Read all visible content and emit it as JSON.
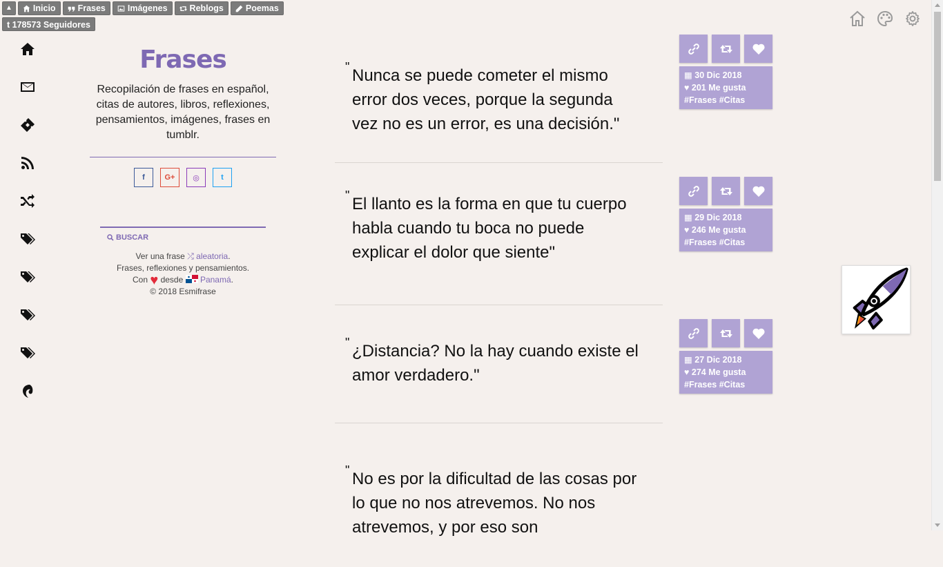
{
  "topbar": {
    "items": [
      {
        "label": "Inicio",
        "icon": "home-icon"
      },
      {
        "label": "Frases",
        "icon": "quote-icon"
      },
      {
        "label": "Imágenes",
        "icon": "image-icon"
      },
      {
        "label": "Reblogs",
        "icon": "retweet-icon"
      },
      {
        "label": "Poemas",
        "icon": "pencil-icon"
      }
    ],
    "followers_label": "178573 Seguidores"
  },
  "sidebar": {
    "title": "Frases",
    "description": "Recopilación de frases en español, citas de autores, libros, reflexiones, pensamientos, imágenes, frases en tumblr.",
    "search_label": "BUSCAR",
    "footer": {
      "line1_prefix": "Ver una frase",
      "line1_link": "aleatoria",
      "line1_suffix": ".",
      "line2": "Frases, reflexiones y pensamientos.",
      "line3_prefix": "Con",
      "line3_mid": "desde",
      "line3_link": "Panamá",
      "line3_suffix": ".",
      "line4": "© 2018 Esmifrase"
    },
    "social": [
      "f",
      "G+",
      "◎",
      "t"
    ]
  },
  "posts": [
    {
      "quote": "Nunca se puede cometer el mismo error dos veces, porque la segunda vez no es un error, es una decisión.\"",
      "date": "30 Dic 2018",
      "likes": "201 Me gusta",
      "tags": "#Frases #Citas"
    },
    {
      "quote": "El llanto es la forma en que tu cuerpo habla cuando tu boca no puede explicar el dolor que siente\"",
      "date": "29 Dic 2018",
      "likes": "246 Me gusta",
      "tags": "#Frases #Citas"
    },
    {
      "quote": "¿Distancia? No la hay cuando existe el amor verdadero.\"",
      "date": "27 Dic 2018",
      "likes": "274 Me gusta",
      "tags": "#Frases #Citas"
    },
    {
      "quote": "No es por la dificultad de las cosas por lo que no nos atrevemos. No nos atrevemos, y por eso son"
    }
  ],
  "colors": {
    "accent": "#7e69b3",
    "meta_bg": "#b0a3d4",
    "page_bg": "#f5f0ed"
  }
}
